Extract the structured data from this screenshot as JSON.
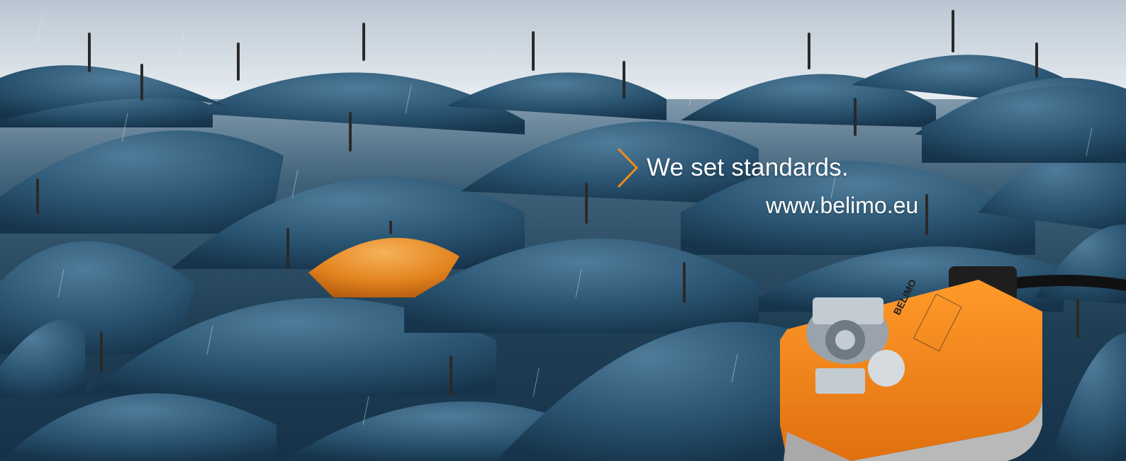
{
  "slogan": "We set standards.",
  "website": "www.belimo.eu",
  "product_logo": "BELIMO",
  "colors": {
    "accent": "#f08a1c",
    "umbrella_blue": "#2b5673",
    "text": "#ffffff",
    "sky": "#e7ecf0"
  },
  "icons": {
    "chevron": "chevron-right-icon"
  }
}
